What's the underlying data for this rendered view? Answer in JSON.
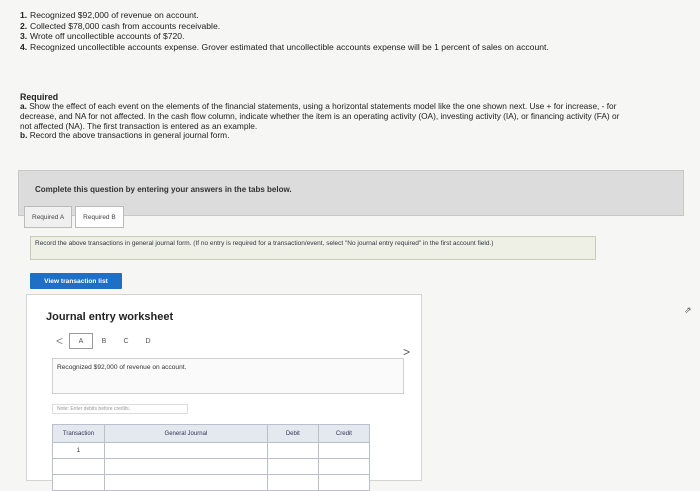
{
  "events": [
    {
      "num": "1.",
      "text": "Recognized $92,000 of revenue on account."
    },
    {
      "num": "2.",
      "text": "Collected $78,000 cash from accounts receivable."
    },
    {
      "num": "3.",
      "text": "Wrote off uncollectible accounts of $720."
    },
    {
      "num": "4.",
      "text": "Recognized uncollectible accounts expense. Grover estimated that uncollectible accounts expense will be 1 percent of sales on account."
    }
  ],
  "required": {
    "title": "Required",
    "a_label": "a.",
    "a_text": "Show the effect of each event on the elements of the financial statements, using a horizontal statements model like the one shown next. Use + for increase, - for decrease, and NA for not affected. In the cash flow column, indicate whether the item is an operating activity (OA), investing activity (IA), or financing activity (FA) or not affected (NA). The first transaction is entered as an example.",
    "b_label": "b.",
    "b_text": "Record the above transactions in general journal form."
  },
  "banner_text": "Complete this question by entering your answers in the tabs below.",
  "tabs": [
    {
      "label": "Required A"
    },
    {
      "label": "Required B"
    }
  ],
  "instruction": "Record the above transactions in general journal form. (If no entry is required for a transaction/event, select \"No journal entry required\" in the first account field.)",
  "view_button": "View transaction list",
  "worksheet": {
    "title": "Journal entry worksheet",
    "prev": "<",
    "next": ">",
    "letters": [
      "A",
      "B",
      "C",
      "D"
    ],
    "description": "Recognized $92,000 of revenue on account.",
    "note": "Note: Enter debits before credits."
  },
  "table": {
    "headers": [
      "Transaction",
      "General Journal",
      "Debit",
      "Credit"
    ],
    "rows": [
      [
        "1",
        "",
        "",
        ""
      ],
      [
        "",
        "",
        "",
        ""
      ],
      [
        "",
        "",
        "",
        ""
      ]
    ]
  }
}
